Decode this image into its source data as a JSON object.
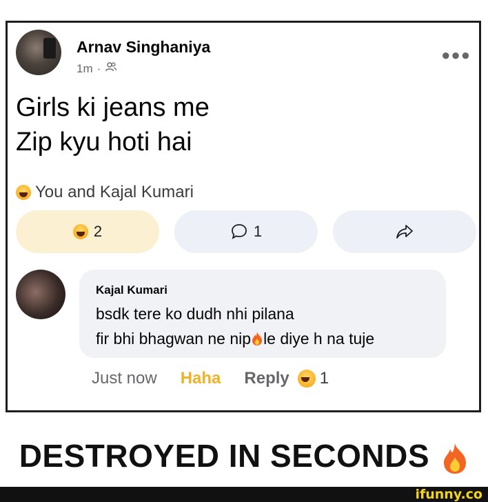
{
  "post": {
    "author": "Arnav Singhaniya",
    "time": "1m",
    "separator": "·",
    "text_line1": "Girls ki jeans me",
    "text_line2": "Zip kyu hoti hai",
    "reaction_summary": "You and Kajal Kumari",
    "reaction_count": "2",
    "comment_count": "1",
    "more_icon": "more-options-icon",
    "audience_icon": "friends-icon"
  },
  "comment": {
    "author": "Kajal Kumari",
    "text_line1": "bsdk tere ko dudh nhi pilana",
    "text_line2_a": "fir bhi bhagwan ne nip",
    "text_line2_b": "le diye h na tuje",
    "time": "Just now",
    "reaction_label": "Haha",
    "reply_label": "Reply",
    "reaction_count": "1"
  },
  "caption": "DESTROYED IN SECONDS",
  "watermark": "ifunny.co",
  "colors": {
    "haha_yellow": "#f7b125",
    "haha_text": "#f0b229",
    "pill_active": "#fbf1d2",
    "pill_neutral": "#eef0f7",
    "bubble": "#f0f2f5"
  }
}
